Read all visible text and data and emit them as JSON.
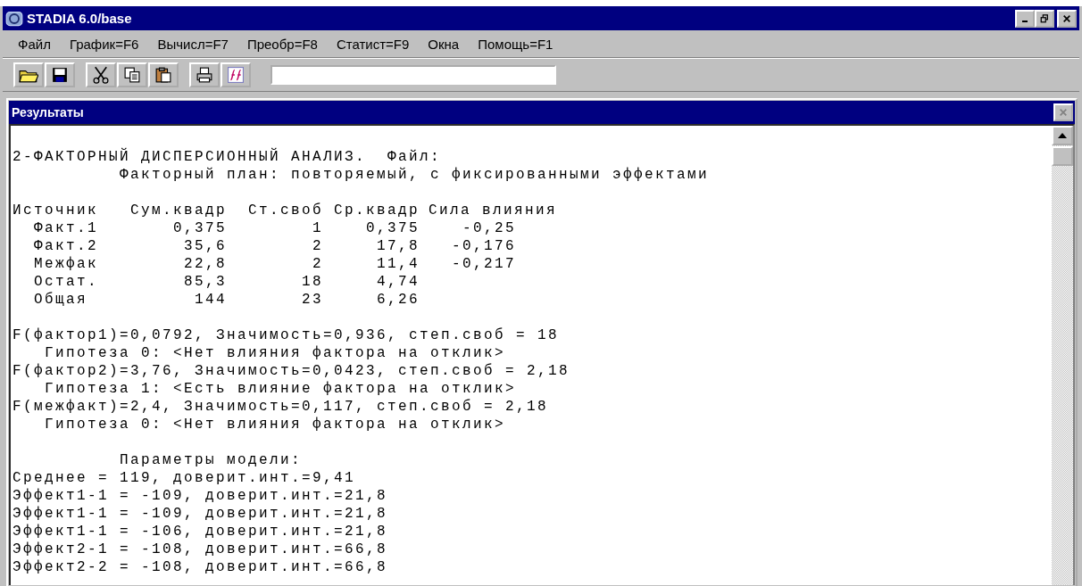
{
  "window": {
    "title": "STADIA 6.0/base"
  },
  "menu": [
    {
      "label": "Файл"
    },
    {
      "label": "График=F6"
    },
    {
      "label": "Вычисл=F7"
    },
    {
      "label": "Преобр=F8"
    },
    {
      "label": "Статист=F9"
    },
    {
      "label": "Окна"
    },
    {
      "label": "Помощь=F1"
    }
  ],
  "toolbar": [
    {
      "buttons": [
        {
          "kind": "open"
        },
        {
          "kind": "save"
        }
      ]
    },
    {
      "buttons": [
        {
          "kind": "cut"
        },
        {
          "kind": "copy"
        },
        {
          "kind": "paste"
        }
      ]
    },
    {
      "buttons": [
        {
          "kind": "print"
        },
        {
          "kind": "fx"
        }
      ]
    }
  ],
  "results": {
    "title": "Результаты",
    "close_disabled": true,
    "heading": [
      {
        "kind": "title",
        "text": "2-ФАКТОРНЫЙ ДИСПЕРСИОННЫЙ АНАЛИЗ.  Файл:"
      },
      {
        "kind": "subtitle",
        "text": "Факторный план: повторяемый, с фиксированными эффектами"
      }
    ],
    "table": {
      "columns": [
        "Источник",
        "Сум.квадр",
        "Ст.своб",
        "Ср.квадр",
        "Сила влияния"
      ],
      "rows": [
        [
          "Факт.1",
          "0,375",
          "1",
          "0,375",
          "-0,25"
        ],
        [
          "Факт.2",
          "35,6",
          "2",
          "17,8",
          "-0,176"
        ],
        [
          "Межфак",
          "22,8",
          "2",
          "11,4",
          "-0,217"
        ],
        [
          "Остат.",
          "85,3",
          "18",
          "4,74"
        ],
        [
          "Общая",
          "144",
          "23",
          "6,26"
        ]
      ]
    },
    "tests": [
      {
        "statistic": "F(фактор1)=0,0792, Значимость=0,936, степ.своб = 18",
        "hypothesis": "Гипотеза 0: <Нет влияния фактора на отклик>"
      },
      {
        "statistic": "F(фактор2)=3,76, Значимость=0,0423, степ.своб = 2,18",
        "hypothesis": "Гипотеза 1: <Есть влияние фактора на отклик>"
      },
      {
        "statistic": "F(межфакт)=2,4, Значимость=0,117, степ.своб = 2,18",
        "hypothesis": "Гипотеза 0: <Нет влияния фактора на отклик>"
      }
    ],
    "model": {
      "title": "Параметры модели:",
      "lines": [
        "Среднее = 119, доверит.инт.=9,41",
        "Эффект1-1 = -109, доверит.инт.=21,8",
        "Эффект1-1 = -109, доверит.инт.=21,8",
        "Эффект1-1 = -106, доверит.инт.=21,8",
        "Эффект2-1 = -108, доверит.инт.=66,8",
        "Эффект2-2 = -108, доверит.инт.=66,8"
      ]
    }
  }
}
